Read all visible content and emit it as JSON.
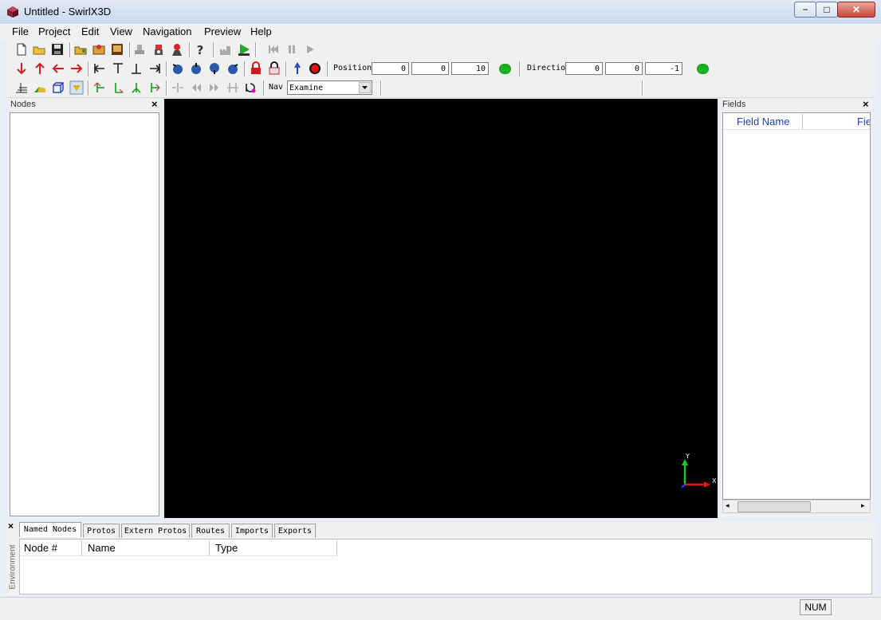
{
  "window": {
    "title": "Untitled - SwirlX3D",
    "min": "−",
    "max": "□",
    "close": "✕"
  },
  "menu": [
    "File",
    "Project",
    "Edit",
    "View",
    "Navigation",
    "Preview",
    "Help"
  ],
  "toolbar": {
    "position_label": "Position",
    "position": [
      "0",
      "0",
      "10"
    ],
    "direction_label": "Directio",
    "direction": [
      "0",
      "0",
      "-1"
    ],
    "go_label": "Go",
    "nav_label": "Nav",
    "nav_value": "Examine"
  },
  "nodes_panel": {
    "title": "Nodes",
    "close": "×"
  },
  "fields_panel": {
    "title": "Fields",
    "close": "×",
    "col1": "Field Name",
    "col2": "Fie"
  },
  "axes": {
    "y": "Y",
    "x": "X"
  },
  "bottom": {
    "close": "×",
    "tabs": [
      "Named Nodes",
      "Protos",
      "Extern Protos",
      "Routes",
      "Imports",
      "Exports"
    ],
    "side_label": "Environment",
    "columns": [
      "Node #",
      "Name",
      "Type"
    ]
  },
  "status": {
    "num": "NUM"
  },
  "colors": {
    "viewport": "#000000",
    "header_text": "#1a3fb8",
    "go": "#1fa81f"
  }
}
